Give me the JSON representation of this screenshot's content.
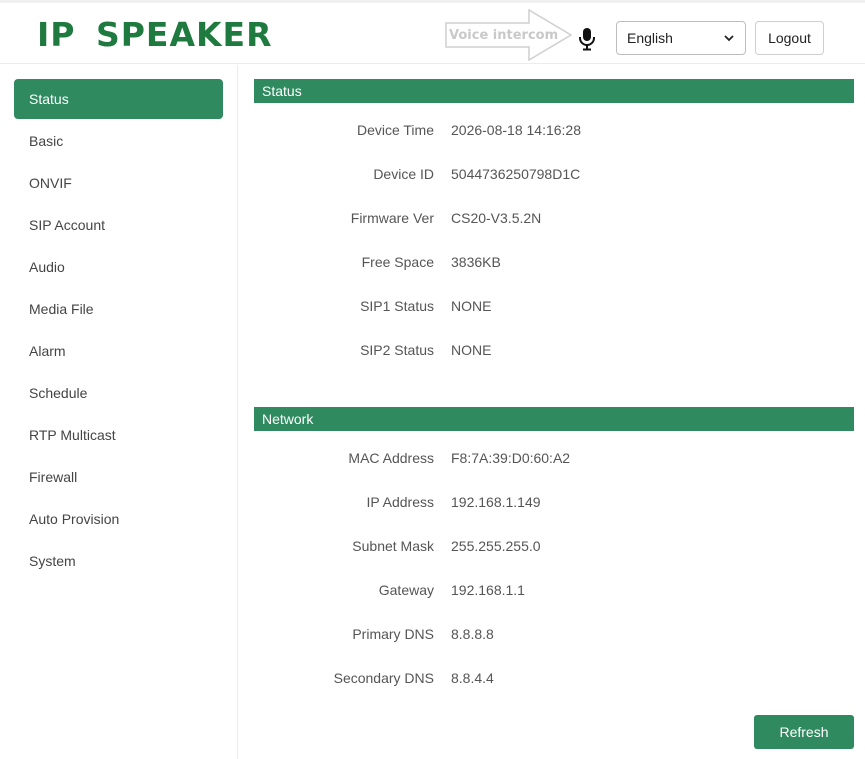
{
  "header": {
    "logo": "IP SPEAKER",
    "hint_text": "Voice intercom",
    "mic_icon": "microphone-icon",
    "language": "English",
    "logout_label": "Logout"
  },
  "sidebar": {
    "items": [
      {
        "label": "Status",
        "active": true
      },
      {
        "label": "Basic"
      },
      {
        "label": "ONVIF"
      },
      {
        "label": "SIP Account"
      },
      {
        "label": "Audio"
      },
      {
        "label": "Media File"
      },
      {
        "label": "Alarm"
      },
      {
        "label": "Schedule"
      },
      {
        "label": "RTP Multicast"
      },
      {
        "label": "Firewall"
      },
      {
        "label": "Auto Provision"
      },
      {
        "label": "System"
      }
    ]
  },
  "status": {
    "title": "Status",
    "rows": [
      {
        "label": "Device Time",
        "value": "2026-08-18 14:16:28"
      },
      {
        "label": "Device ID",
        "value": "5044736250798D1C"
      },
      {
        "label": "Firmware Ver",
        "value": "CS20-V3.5.2N"
      },
      {
        "label": "Free Space",
        "value": "3836KB"
      },
      {
        "label": "SIP1 Status",
        "value": "NONE"
      },
      {
        "label": "SIP2 Status",
        "value": "NONE"
      }
    ]
  },
  "network": {
    "title": "Network",
    "rows": [
      {
        "label": "MAC Address",
        "value": "F8:7A:39:D0:60:A2"
      },
      {
        "label": "IP Address",
        "value": "192.168.1.149"
      },
      {
        "label": "Subnet Mask",
        "value": "255.255.255.0"
      },
      {
        "label": "Gateway",
        "value": "192.168.1.1"
      },
      {
        "label": "Primary DNS",
        "value": "8.8.8.8"
      },
      {
        "label": "Secondary DNS",
        "value": "8.8.4.4"
      }
    ]
  },
  "refresh_label": "Refresh",
  "colors": {
    "accent": "#2f8a5f",
    "logo": "#1f7a3f"
  }
}
